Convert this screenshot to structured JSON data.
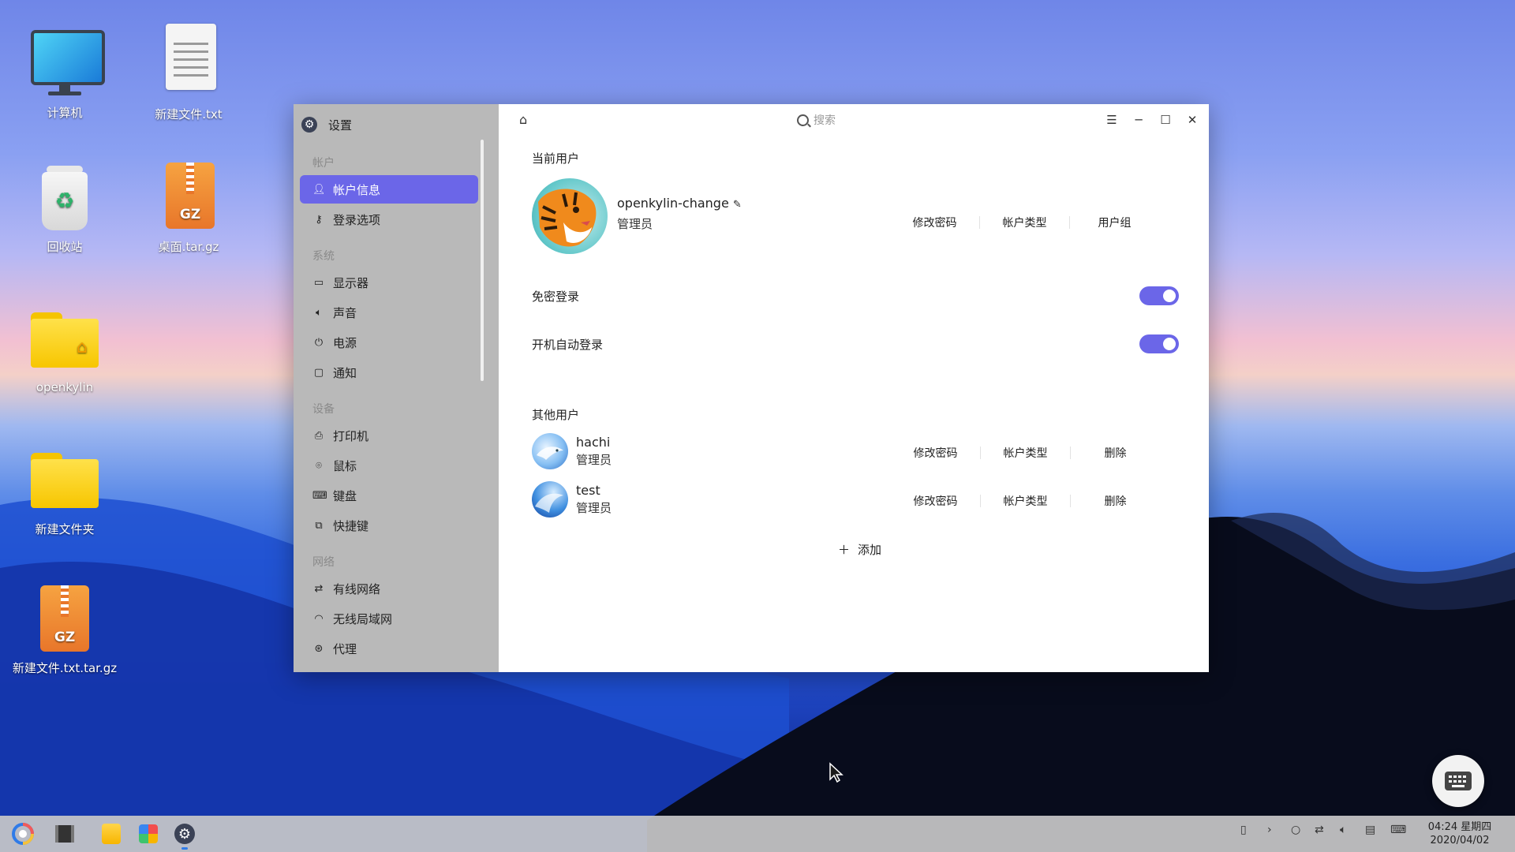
{
  "desktop": {
    "icons": [
      {
        "label": "计算机"
      },
      {
        "label": "新建文件.txt"
      },
      {
        "label": "回收站"
      },
      {
        "label": "桌面.tar.gz",
        "badge": "GZ"
      },
      {
        "label": "openkylin"
      },
      {
        "label": "新建文件夹"
      },
      {
        "label": "新建文件.txt.tar.gz",
        "badge": "GZ"
      }
    ]
  },
  "window": {
    "app_title": "设置",
    "search_placeholder": "搜索",
    "sidebar": {
      "groups": [
        {
          "label": "帐户",
          "items": [
            {
              "label": "帐户信息",
              "icon": "user-icon",
              "active": true
            },
            {
              "label": "登录选项",
              "icon": "key-icon"
            }
          ]
        },
        {
          "label": "系统",
          "items": [
            {
              "label": "显示器",
              "icon": "monitor-icon"
            },
            {
              "label": "声音",
              "icon": "speaker-icon"
            },
            {
              "label": "电源",
              "icon": "power-icon"
            },
            {
              "label": "通知",
              "icon": "chat-bubble-icon"
            }
          ]
        },
        {
          "label": "设备",
          "items": [
            {
              "label": "打印机",
              "icon": "printer-icon"
            },
            {
              "label": "鼠标",
              "icon": "mouse-icon"
            },
            {
              "label": "键盘",
              "icon": "keyboard-icon"
            },
            {
              "label": "快捷键",
              "icon": "shortcut-icon"
            }
          ]
        },
        {
          "label": "网络",
          "items": [
            {
              "label": "有线网络",
              "icon": "wired-network-icon"
            },
            {
              "label": "无线局域网",
              "icon": "wifi-icon"
            },
            {
              "label": "代理",
              "icon": "proxy-icon"
            }
          ]
        }
      ]
    },
    "current_user": {
      "section_title": "当前用户",
      "name": "openkylin-change",
      "role": "管理员",
      "actions": [
        "修改密码",
        "帐户类型",
        "用户组"
      ]
    },
    "toggles": [
      {
        "label": "免密登录",
        "on": true
      },
      {
        "label": "开机自动登录",
        "on": true
      }
    ],
    "other_users": {
      "section_title": "其他用户",
      "users": [
        {
          "name": "hachi",
          "role": "管理员",
          "actions": [
            "修改密码",
            "帐户类型",
            "删除"
          ]
        },
        {
          "name": "test",
          "role": "管理员",
          "actions": [
            "修改密码",
            "帐户类型",
            "删除"
          ]
        }
      ],
      "add_label": "添加"
    }
  },
  "taskbar": {
    "clock_time": "04:24 星期四",
    "clock_date": "2020/04/02"
  },
  "colors": {
    "accent": "#6b66e8",
    "sidebar_bg": "#b9b9b9"
  }
}
